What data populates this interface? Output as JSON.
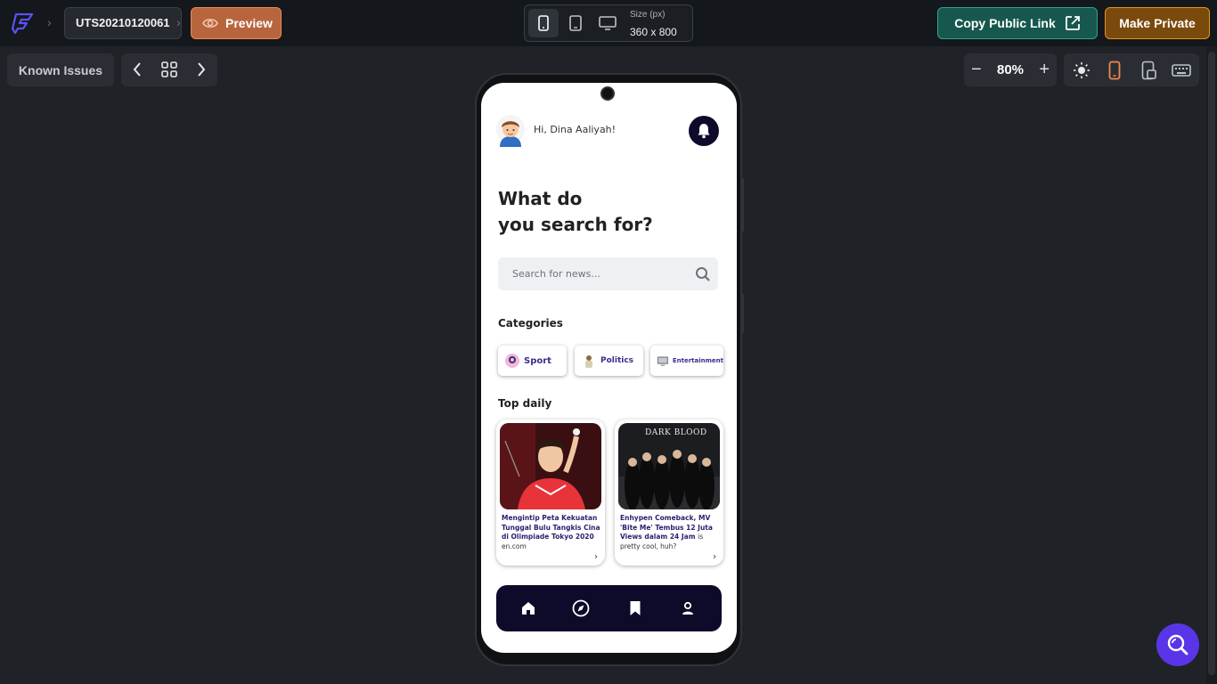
{
  "topbar": {
    "project_name": "UTS20210120061",
    "preview_label": "Preview",
    "size_label": "Size (px)",
    "size_value": "360 x 800",
    "copy_link_label": "Copy Public Link",
    "make_private_label": "Make Private"
  },
  "toolbar": {
    "known_issues_label": "Known Issues",
    "zoom_value": "80%"
  },
  "app": {
    "greeting": "Hi, Dina Aaliyah!",
    "headline_line1": "What do",
    "headline_line2": "you search for?",
    "search_placeholder": "Search for news...",
    "categories_title": "Categories",
    "categories": [
      {
        "label": "Sport"
      },
      {
        "label": "Politics"
      },
      {
        "label": "Entertainment"
      }
    ],
    "top_daily_title": "Top daily",
    "articles": [
      {
        "title": "Mengintip Peta Kekuatan Tunggal Bulu Tangkis Cina di Olimpiade Tokyo 2020",
        "source": "en.com"
      },
      {
        "title": "Enhypen Comeback, MV 'Bite Me' Tembus 12 Juta Views dalam 24 Jam",
        "source": "is pretty cool, huh?",
        "image_text": "DARK BLOOD"
      }
    ]
  },
  "colors": {
    "accent_orange": "#b8653d",
    "teal": "#17584e",
    "amber": "#7a4a0c",
    "navy": "#0d0a2a",
    "fab_purple": "#5a35e8"
  }
}
